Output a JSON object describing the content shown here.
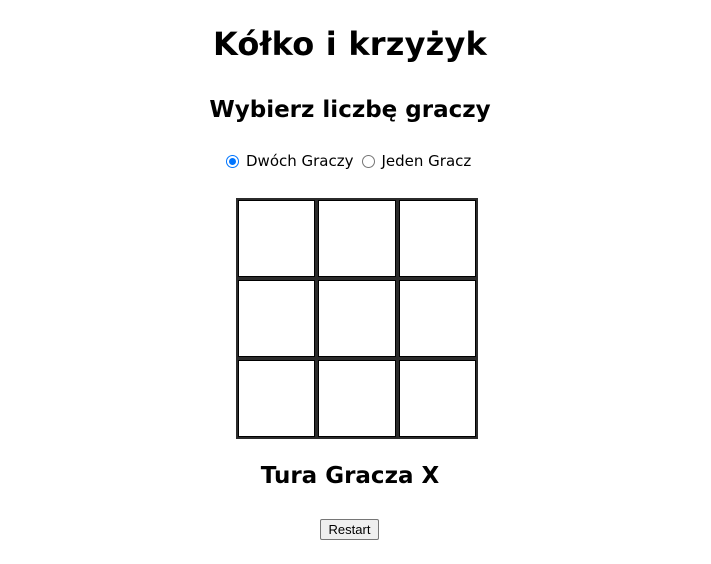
{
  "title": "Kółko i krzyżyk",
  "player_select": {
    "heading": "Wybierz liczbę graczy",
    "options": [
      {
        "label": "Dwóch Graczy",
        "checked": true
      },
      {
        "label": "Jeden Gracz",
        "checked": false
      }
    ]
  },
  "board": {
    "cells": [
      "",
      "",
      "",
      "",
      "",
      "",
      "",
      "",
      ""
    ]
  },
  "status": "Tura Gracza X",
  "restart_label": "Restart",
  "colors": {
    "radio_accent": "#0075ff",
    "board_lines": "#000000"
  }
}
